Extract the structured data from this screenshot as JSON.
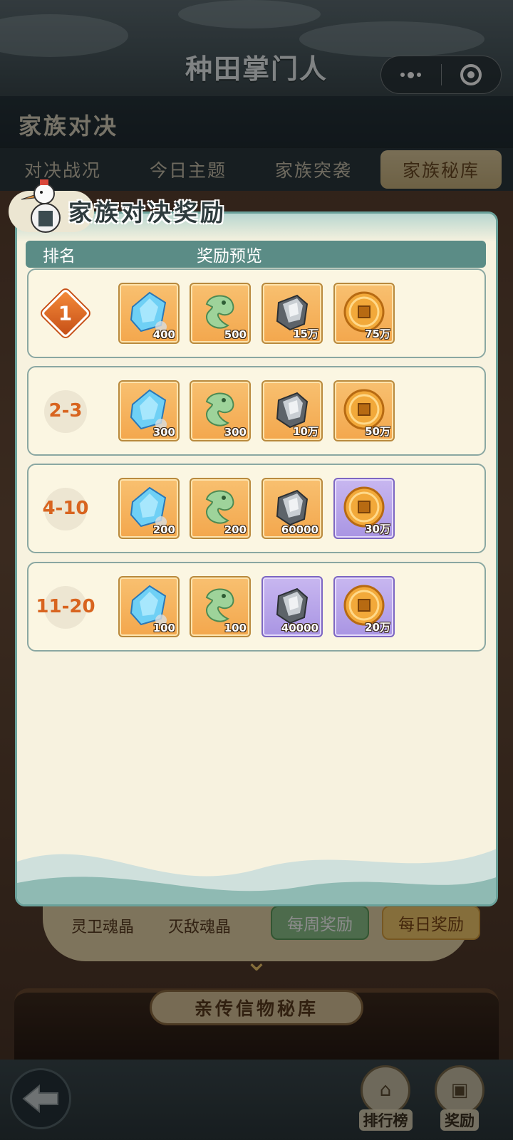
{
  "app": {
    "title": "种田掌门人"
  },
  "page": {
    "title": "家族对决"
  },
  "tabs": [
    {
      "label": "对决战况"
    },
    {
      "label": "今日主题"
    },
    {
      "label": "家族突袭"
    },
    {
      "label": "家族秘库",
      "active": true
    }
  ],
  "background": {
    "label_left": "灵卫魂晶",
    "label_mid": "灭敌魂晶",
    "weekly_button": "每周奖励",
    "daily_button": "每日奖励",
    "plaque": "亲传信物秘库"
  },
  "bottom_nav": {
    "ranking": "排行榜",
    "rewards": "奖励"
  },
  "modal": {
    "title": "家族对决奖励",
    "col_rank": "排名",
    "col_rewards": "奖励预览",
    "rows": [
      {
        "rank": "1",
        "items": [
          {
            "icon": "blue-crystal-icon",
            "qty": "400",
            "rarity": "orange"
          },
          {
            "icon": "jade-dragon-icon",
            "qty": "500",
            "rarity": "orange"
          },
          {
            "icon": "iron-ore-icon",
            "qty": "15万",
            "rarity": "orange"
          },
          {
            "icon": "copper-coin-icon",
            "qty": "75万",
            "rarity": "orange"
          }
        ]
      },
      {
        "rank": "2-3",
        "items": [
          {
            "icon": "blue-crystal-icon",
            "qty": "300",
            "rarity": "orange"
          },
          {
            "icon": "jade-dragon-icon",
            "qty": "300",
            "rarity": "orange"
          },
          {
            "icon": "iron-ore-icon",
            "qty": "10万",
            "rarity": "orange"
          },
          {
            "icon": "copper-coin-icon",
            "qty": "50万",
            "rarity": "orange"
          }
        ]
      },
      {
        "rank": "4-10",
        "items": [
          {
            "icon": "blue-crystal-icon",
            "qty": "200",
            "rarity": "orange"
          },
          {
            "icon": "jade-dragon-icon",
            "qty": "200",
            "rarity": "orange"
          },
          {
            "icon": "iron-ore-icon",
            "qty": "60000",
            "rarity": "orange"
          },
          {
            "icon": "copper-coin-icon",
            "qty": "30万",
            "rarity": "purple"
          }
        ]
      },
      {
        "rank": "11-20",
        "items": [
          {
            "icon": "blue-crystal-icon",
            "qty": "100",
            "rarity": "orange"
          },
          {
            "icon": "jade-dragon-icon",
            "qty": "100",
            "rarity": "orange"
          },
          {
            "icon": "iron-ore-icon",
            "qty": "40000",
            "rarity": "purple"
          },
          {
            "icon": "copper-coin-icon",
            "qty": "20万",
            "rarity": "purple"
          }
        ]
      }
    ]
  }
}
